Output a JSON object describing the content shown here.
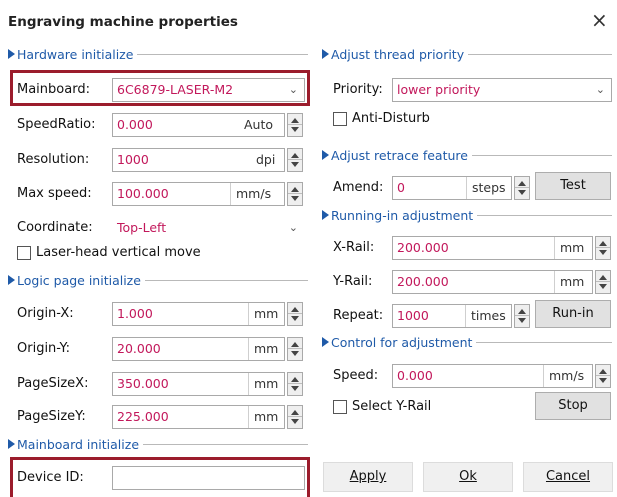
{
  "window": {
    "title": "Engraving machine properties",
    "close_glyph": "×"
  },
  "hardware": {
    "header": "Hardware initialize",
    "mainboard_label": "Mainboard:",
    "mainboard_value": "6C6879-LASER-M2",
    "speedratio_label": "SpeedRatio:",
    "speedratio_value": "0.000",
    "speedratio_unit": "Auto",
    "resolution_label": "Resolution:",
    "resolution_value": "1000",
    "resolution_unit": "dpi",
    "maxspeed_label": "Max speed:",
    "maxspeed_value": "100.000",
    "maxspeed_unit": "mm/s",
    "coordinate_label": "Coordinate:",
    "coordinate_value": "Top-Left",
    "laserhead_label": "Laser-head vertical move"
  },
  "logic_page": {
    "header": "Logic page initialize",
    "origin_x_label": "Origin-X:",
    "origin_x_value": "1.000",
    "origin_y_label": "Origin-Y:",
    "origin_y_value": "20.000",
    "pagesize_x_label": "PageSizeX:",
    "pagesize_x_value": "350.000",
    "pagesize_y_label": "PageSizeY:",
    "pagesize_y_value": "225.000",
    "unit": "mm"
  },
  "mainboard_init": {
    "header": "Mainboard initialize",
    "device_id_label": "Device ID:",
    "device_id_value": ""
  },
  "thread_priority": {
    "header": "Adjust thread priority",
    "priority_label": "Priority:",
    "priority_value": "lower priority",
    "anti_disturb_label": "Anti-Disturb"
  },
  "retrace": {
    "header": "Adjust retrace feature",
    "amend_label": "Amend:",
    "amend_value": "0",
    "amend_unit": "steps",
    "test_label": "Test"
  },
  "running_in": {
    "header": "Running-in adjustment",
    "xrail_label": "X-Rail:",
    "xrail_value": "200.000",
    "yrail_label": "Y-Rail:",
    "yrail_value": "200.000",
    "unit": "mm",
    "repeat_label": "Repeat:",
    "repeat_value": "1000",
    "repeat_unit": "times",
    "runin_label": "Run-in"
  },
  "control": {
    "header": "Control for adjustment",
    "speed_label": "Speed:",
    "speed_value": "0.000",
    "speed_unit": "mm/s",
    "select_yrail_label": "Select Y-Rail",
    "stop_label": "Stop"
  },
  "footer": {
    "apply_label": "Apply",
    "ok_label": "Ok",
    "cancel_label": "Cancel"
  },
  "colors": {
    "group_header": "#1f5aa8",
    "value_text": "#c2185b",
    "highlight_box": "#9b1c2c"
  },
  "icons": [
    "close-icon",
    "group-triangle-icon",
    "dropdown-chevron-icon",
    "spin-up-icon",
    "spin-down-icon",
    "checkbox"
  ]
}
